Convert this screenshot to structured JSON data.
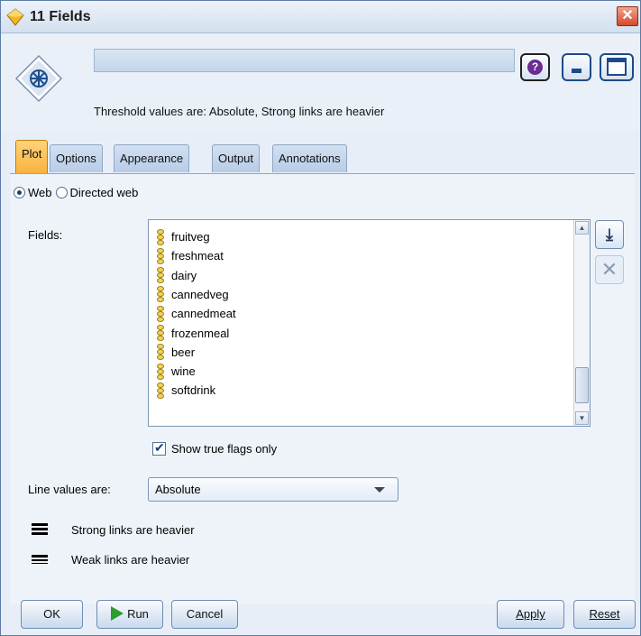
{
  "window": {
    "title": "11 Fields"
  },
  "header": {
    "threshold_text": "Threshold values are: Absolute,   Strong links are heavier"
  },
  "tabs": [
    {
      "label": "Plot",
      "active": true
    },
    {
      "label": "Options",
      "active": false
    },
    {
      "label": "Appearance",
      "active": false
    },
    {
      "label": "Output",
      "active": false
    },
    {
      "label": "Annotations",
      "active": false
    }
  ],
  "plot": {
    "mode": {
      "web_label": "Web",
      "directed_label": "Directed web",
      "selected": "Web"
    },
    "fields_label": "Fields:",
    "fields": [
      "fruitveg",
      "freshmeat",
      "dairy",
      "cannedveg",
      "cannedmeat",
      "frozenmeal",
      "beer",
      "wine",
      "softdrink"
    ],
    "show_true_flags_label": "Show true flags only",
    "show_true_flags_checked": true,
    "line_values_label": "Line values are:",
    "line_values_selected": "Absolute",
    "legend": {
      "strong_label": "Strong links are heavier",
      "weak_label": "Weak links are heavier"
    }
  },
  "buttons": {
    "ok": "OK",
    "run": "Run",
    "cancel": "Cancel",
    "apply": "Apply",
    "reset": "Reset"
  },
  "colors": {
    "active_tab": "#f7b33f",
    "run_icon": "#2e9b2e",
    "close_button": "#d4492a"
  }
}
